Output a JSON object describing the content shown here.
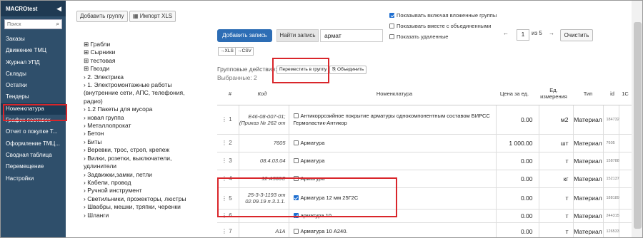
{
  "sidebar": {
    "brand": "MACROtest",
    "collapse_icon": "chevron-left-icon",
    "search_placeholder": "Поиск",
    "items": [
      {
        "label": "Заказы"
      },
      {
        "label": "Движение ТМЦ"
      },
      {
        "label": "Журнал УПД"
      },
      {
        "label": "Склады"
      },
      {
        "label": "Остатки"
      },
      {
        "label": "Тендеры"
      },
      {
        "label": "Номенклатура",
        "active": true
      },
      {
        "label": "График поставок"
      },
      {
        "label": "Отчет о покупке Т..."
      },
      {
        "label": "Оформление ТМЦ..."
      },
      {
        "label": "Сводная таблица"
      },
      {
        "label": "Перемещение"
      },
      {
        "label": "Настройки"
      }
    ]
  },
  "toolbar": {
    "add_group": "Добавить группу",
    "import_xls": "Импорт XLS",
    "xls_btn": "→XLS",
    "csv_btn": "→CSV"
  },
  "tree": [
    "⊞ Грабли",
    "⊞ Сырники",
    "⊞ тестовая",
    "⊞ Гвозди",
    "› 2. Электрика",
    "› 1. Электромонтажные работы (внутренние сети, АПС, телефония, радио)",
    "› 1.2 Пакеты для мусора",
    "› новая группа",
    "› Металлопрокат",
    "› Бетон",
    "› Биты",
    "› Веревки, трос, строп, крепеж",
    "› Вилки, розетки, выключатели, удлинители",
    "› Задвижки,замки, петли",
    "› Кабели, провод",
    "› Ручной инструмент",
    "› Светильники, прожекторы, люстры",
    "› Швабры, мешки, тряпки, черенки",
    "› Шланги"
  ],
  "main": {
    "add_record": "Добавить запись",
    "find_record": "Найти запись",
    "search_value": "армат",
    "options": [
      {
        "label": "Показывать включая вложенные группы",
        "checked": true
      },
      {
        "label": "Показывать вместе с объединенными",
        "checked": false
      },
      {
        "label": "Показать удаленные",
        "checked": false
      }
    ],
    "pager": {
      "prev": "←",
      "page": "1",
      "of": "из 5",
      "next": "→"
    },
    "clear": "Очистить",
    "group_actions_label": "Групповые действия:",
    "move_to_group": "Переместить в группу",
    "merge": "Объединить",
    "selected_label": "Выбранные: 2"
  },
  "table": {
    "headers": {
      "hash": "#",
      "code": "Код",
      "name": "Номенклатура",
      "price": "Цена за ед.",
      "unit": "Ед. измерения",
      "type": "Тип",
      "id": "id",
      "c1": "1С"
    },
    "rows": [
      {
        "num": "1",
        "code": "Е46-08-007-01; (Приказ № 262 от",
        "name": "Антикоррозийное покрытие арматуры однокомпонентным составом БИРСС Гермоластик-Антикор",
        "checked": false,
        "price": "0.00",
        "unit": "м2",
        "type": "Материал",
        "id": "184732"
      },
      {
        "num": "2",
        "code": "7605",
        "name": "Арматура",
        "checked": false,
        "price": "1 000.00",
        "unit": "шт",
        "type": "Материал",
        "id": "7605"
      },
      {
        "num": "3",
        "code": "08.4.03.04",
        "name": "Арматура",
        "checked": false,
        "price": "0.00",
        "unit": "т",
        "type": "Материал",
        "id": "158788"
      },
      {
        "num": "4",
        "code": "12 А500С",
        "name": "Арматура",
        "checked": false,
        "price": "0.00",
        "unit": "кг",
        "type": "Материал",
        "id": "152137"
      },
      {
        "num": "5",
        "code": "25-3-3-1193 от 02.09.19 п.3.1.1.",
        "name": "Арматура 12 мм 25Г2С",
        "checked": true,
        "price": "0.00",
        "unit": "т",
        "type": "Материал",
        "id": "188189"
      },
      {
        "num": "6",
        "code": "",
        "name": "арматура 10",
        "checked": true,
        "price": "0.00",
        "unit": "т",
        "type": "Материал",
        "id": "244315"
      },
      {
        "num": "7",
        "code": "А1А",
        "name": "Арматура 10 А240.",
        "checked": false,
        "price": "0.00",
        "unit": "т",
        "type": "Материал",
        "id": "126533"
      }
    ]
  }
}
